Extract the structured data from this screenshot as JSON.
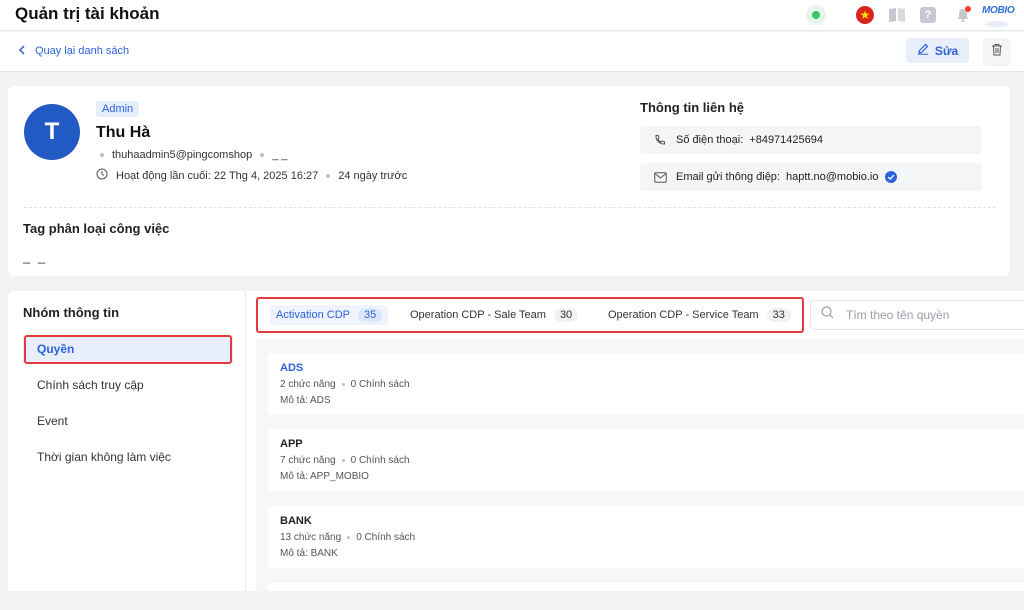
{
  "header": {
    "title": "Quản trị tài khoản"
  },
  "backbar": {
    "back_label": "Quay lại danh sách",
    "edit_label": "Sửa"
  },
  "profile": {
    "avatar_initial": "T",
    "role": "Admin",
    "name": "Thu Hà",
    "username": "thuhaadmin5@pingcomshop",
    "extra": "_ _",
    "last_active": "Hoạt động lần cuối: 22 Thg 4, 2025 16:27",
    "ago": "24 ngày trước"
  },
  "contact": {
    "title": "Thông tin liên hệ",
    "phone_label": "Số điện thoại:",
    "phone": "+84971425694",
    "email_label": "Email gửi thông điệp:",
    "email": "haptt.no@mobio.io"
  },
  "tags": {
    "title": "Tag phân loại công việc",
    "value": "_ _"
  },
  "nav": {
    "title": "Nhóm thông tin",
    "items": [
      {
        "label": "Quyền"
      },
      {
        "label": "Chính sách truy cập"
      },
      {
        "label": "Event"
      },
      {
        "label": "Thời gian không làm việc"
      }
    ]
  },
  "tabs": [
    {
      "label": "Activation CDP",
      "count": "35"
    },
    {
      "label": "Operation CDP - Sale Team",
      "count": "30"
    },
    {
      "label": "Operation CDP - Service Team",
      "count": "33"
    }
  ],
  "search": {
    "placeholder": "Tìm theo tên quyền"
  },
  "permissions": [
    {
      "name": "ADS",
      "features": "2 chức năng",
      "policies": "0 Chính sách",
      "desc": "Mô tả: ADS"
    },
    {
      "name": "APP",
      "features": "7 chức năng",
      "policies": "0 Chính sách",
      "desc": "Mô tả: APP_MOBIO"
    },
    {
      "name": "BANK",
      "features": "13 chức năng",
      "policies": "0 Chính sách",
      "desc": "Mô tả: BANK"
    }
  ],
  "logo": {
    "text": "MOBIO"
  },
  "colors": {
    "accent": "#2b62d9",
    "avatar": "#2359c2",
    "highlight_box": "#e23b3b"
  },
  "icons": [
    "online-status-icon",
    "vietnam-flag-icon",
    "book-icon",
    "help-icon",
    "bell-icon",
    "pencil-icon",
    "trash-icon",
    "phone-icon",
    "mail-icon",
    "verified-icon",
    "clock-icon",
    "search-icon",
    "chevron-left-icon"
  ]
}
